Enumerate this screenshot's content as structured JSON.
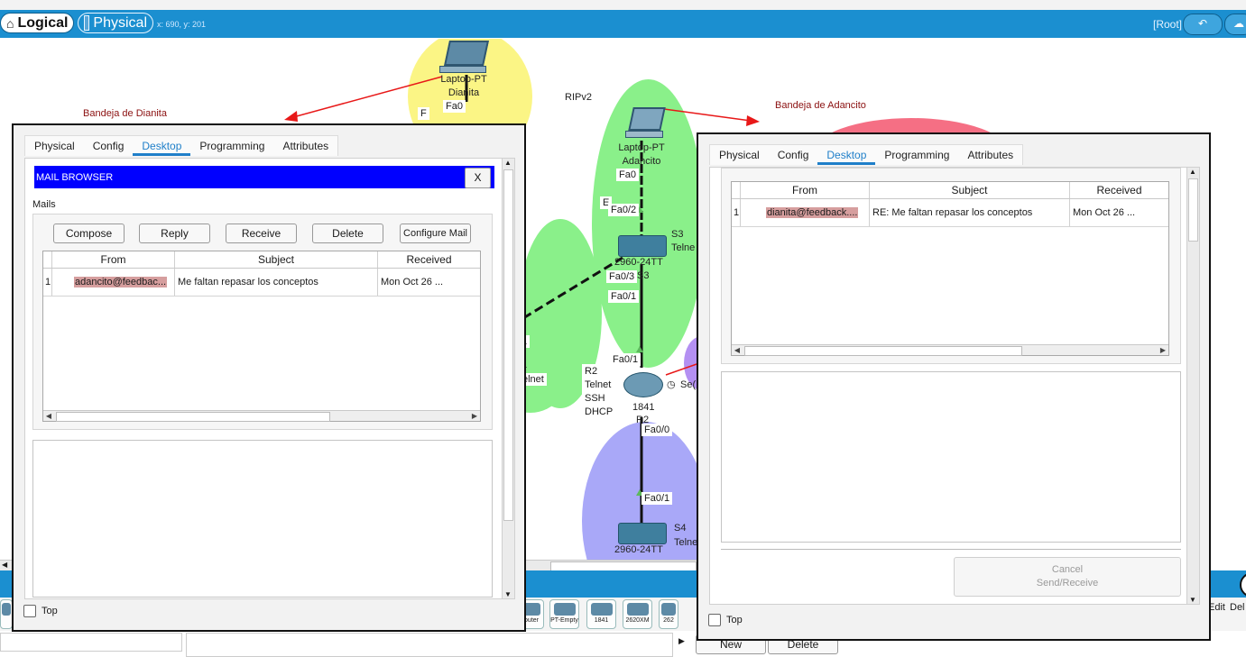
{
  "toolbar": {
    "logical_label": "Logical",
    "physical_label": "Physical",
    "coords": "x: 690, y: 201",
    "root_label": "[Root]"
  },
  "canvas": {
    "laptop_dianita": {
      "line1": "Laptop-PT",
      "line2": "Dianita",
      "port": "Fa0",
      "port2": "F"
    },
    "laptop_adancito": {
      "line1": "Laptop-PT",
      "line2": "Adancito",
      "port_fa0": "Fa0"
    },
    "rip_label": "RIPv2",
    "tray_dianita": "Bandeja de Dianita",
    "tray_adancito": "Bandeja de Adancito",
    "switch_s3": {
      "model": "2960-24TT",
      "name": "S3",
      "tag": "Telne",
      "port_fa02": "Fa0/2",
      "port_fa03": "Fa0/3",
      "port_fa01": "Fa0/1",
      "port_e": "E",
      "suffix": "S3"
    },
    "router_r2": {
      "model": "1841",
      "name": "R2",
      "services": [
        "Telnet",
        "SSH",
        "DHCP"
      ],
      "port_fa01": "Fa0/1",
      "port_fa00": "Fa0/0",
      "port_se": "Se(",
      "sub": "R2"
    },
    "switch_s4": {
      "model": "2960-24TT",
      "name": "S4",
      "tag": "Telne",
      "port_fa01": "Fa0/1"
    },
    "left_ports": {
      "fa01": "/1",
      "one": "1",
      "telnet": "elnet"
    },
    "hidden_text": "t"
  },
  "window_dianita": {
    "tabs": [
      "Physical",
      "Config",
      "Desktop",
      "Programming",
      "Attributes"
    ],
    "active_tab": "Desktop",
    "title": "MAIL BROWSER",
    "close_label": "X",
    "mails_label": "Mails",
    "buttons": [
      "Compose",
      "Reply",
      "Receive",
      "Delete",
      "Configure Mail"
    ],
    "columns": [
      "From",
      "Subject",
      "Received"
    ],
    "rows": [
      {
        "num": "1",
        "from": "adancito@feedbac...",
        "subject": "Me faltan repasar los conceptos",
        "received": "Mon Oct 26 ..."
      }
    ],
    "top_label": "Top"
  },
  "window_adancito": {
    "tabs": [
      "Physical",
      "Config",
      "Desktop",
      "Programming",
      "Attributes"
    ],
    "active_tab": "Desktop",
    "columns": [
      "From",
      "Subject",
      "Received"
    ],
    "rows": [
      {
        "num": "1",
        "from": "dianita@feedback....",
        "subject": "RE: Me faltan repasar los conceptos",
        "received": "Mon Oct 26 ..."
      }
    ],
    "cancel_line1": "Cancel",
    "cancel_line2": "Send/Receive",
    "top_label": "Top"
  },
  "devices": {
    "items": [
      "Router",
      "PT-Empty",
      "1841",
      "2620XM",
      "262"
    ],
    "new_label": "New",
    "delete_label": "Delete",
    "edit_label": "Edit",
    "del_label": "Del"
  },
  "colors": {
    "accent": "#1b8fd0",
    "tab_active": "#1f7fc9",
    "mail_title": "#0000ff",
    "highlight": "#d69e9e",
    "tray_label": "#8b1010"
  }
}
